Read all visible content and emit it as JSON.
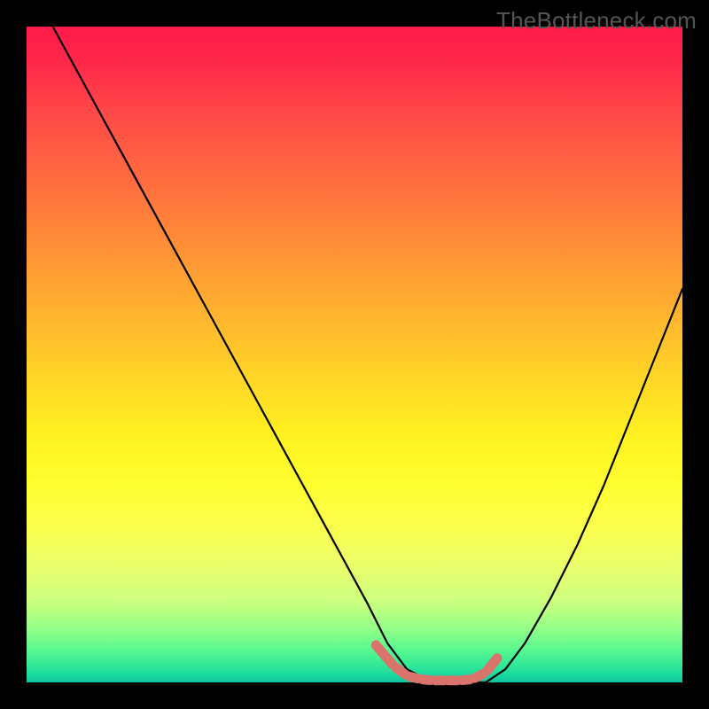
{
  "watermark": "TheBottleneck.com",
  "chart_data": {
    "type": "line",
    "title": "",
    "xlabel": "",
    "ylabel": "",
    "xlim": [
      0,
      100
    ],
    "ylim": [
      0,
      100
    ],
    "description": "Bottleneck curve over a red-to-green vertical gradient background. Black curve descends from upper-left to a flat minimum around x≈55–70, then rises toward right. A pinkish segmented series overlays the bottom of the trough.",
    "series": [
      {
        "name": "bottleneck-curve",
        "color": "#000000",
        "x": [
          4,
          10,
          16,
          22,
          28,
          34,
          40,
          46,
          52,
          55,
          58,
          62,
          66,
          70,
          73,
          76,
          80,
          84,
          88,
          92,
          96,
          100
        ],
        "values": [
          100,
          89,
          78,
          67,
          56,
          45,
          34,
          23,
          12,
          6,
          2,
          0,
          0,
          0,
          2,
          6,
          13,
          21,
          30,
          40,
          50,
          60
        ]
      },
      {
        "name": "highlight-segments",
        "color": "#d9736b",
        "x": [
          53,
          56,
          58,
          60,
          62,
          64,
          66,
          68,
          70,
          72
        ],
        "values": [
          6,
          2.5,
          1,
          0.5,
          0.3,
          0.3,
          0.3,
          0.5,
          1.5,
          4
        ]
      }
    ]
  }
}
